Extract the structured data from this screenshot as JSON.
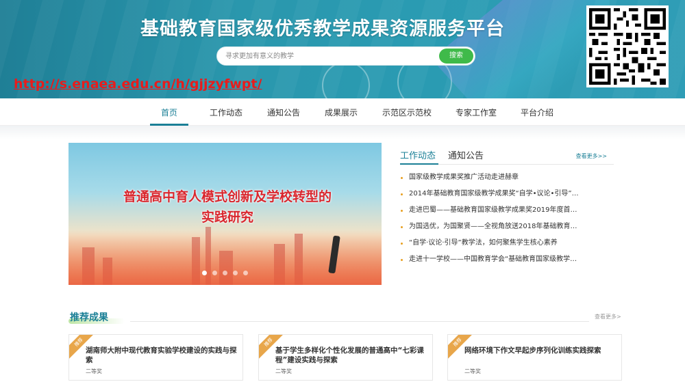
{
  "header": {
    "site_title": "基础教育国家级优秀教学成果资源服务平台",
    "search_placeholder": "寻求更加有意义的教学",
    "search_button": "搜索",
    "url_text": "http://s.enaea.edu.cn/h/gjjzyfwpt/",
    "qr_icon": "qr-code"
  },
  "nav": {
    "items": [
      "首页",
      "工作动态",
      "通知公告",
      "成果展示",
      "示范区示范校",
      "专家工作室",
      "平台介绍"
    ],
    "active": "首页"
  },
  "hero": {
    "line1": "普通高中育人模式创新及学校转型的",
    "line2": "实践研究"
  },
  "news": {
    "tabs": [
      "工作动态",
      "通知公告"
    ],
    "more": "查看更多>>",
    "items": [
      "国家级教学成果奖推广活动走进赫章",
      "2014年基础教育国家级教学成果奖“自学•议论•引导”…",
      "走进巴蜀——基础教育国家级教学成果奖2019年度首…",
      "为国选优，为国聚贤——全视角放送2018年基础教育…",
      "“自学·议论·引导”教学法，如何聚焦学生核心素养",
      "走进十一学校——中国教育学会“基础教育国家级教学…"
    ]
  },
  "recommended": {
    "title": "推荐成果",
    "more": "查看更多>",
    "cards": [
      {
        "tag": "推荐",
        "title": "湖南师大附中现代教育实验学校建设的实践与探索",
        "award": "二等奖"
      },
      {
        "tag": "推荐",
        "title": "基于学生多样化个性化发展的普通高中“七彩课程”建设实践与探索",
        "award": "二等奖"
      },
      {
        "tag": "推荐",
        "title": "网络环境下作文早起步序列化训练实践探索",
        "award": "二等奖"
      }
    ]
  },
  "colors": {
    "accent": "#1a7f96",
    "search_button": "#3fba4a",
    "url_red": "#e81c1c",
    "tag_orange": "#e8a64a"
  }
}
